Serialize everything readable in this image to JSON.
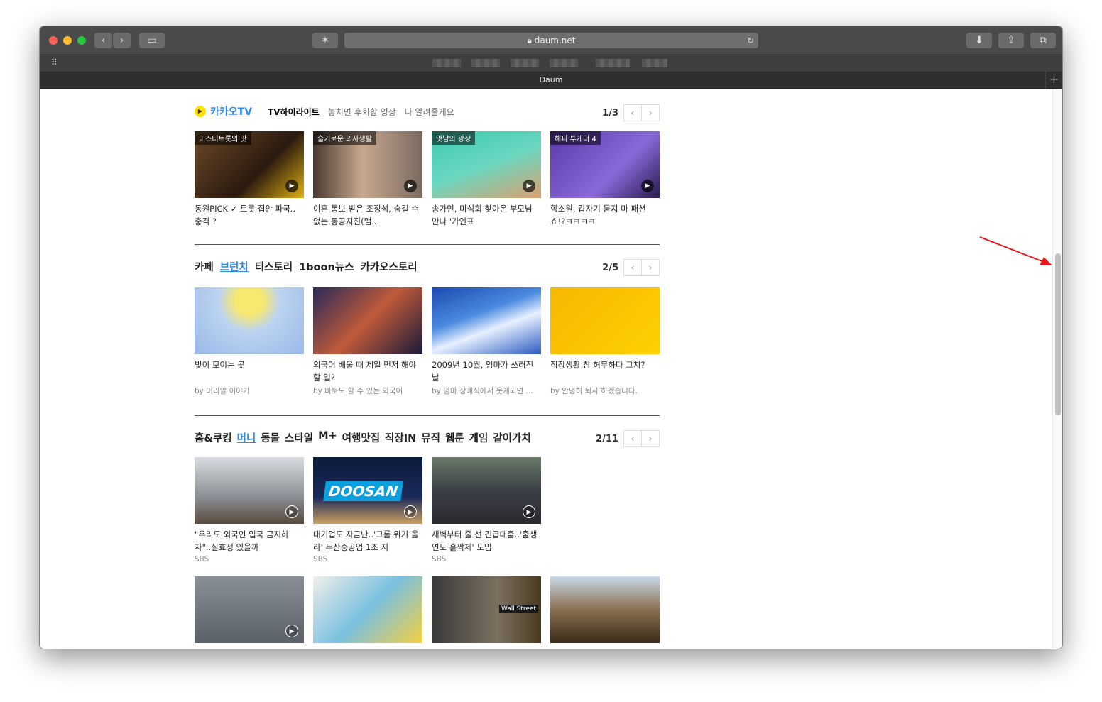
{
  "browser": {
    "url": "daum.net",
    "tab_title": "Daum",
    "new_tab": "+"
  },
  "kakaotv": {
    "brand": "카카오TV",
    "tabs": [
      "TV하이라이트",
      "놓치면 후회할 영상",
      "다 알려줄게요"
    ],
    "page": "1/3",
    "items": [
      {
        "tag": "미스터트롯의 맛",
        "title": "동원PICK ✓ 트롯 집안 파국.. 충격 ?"
      },
      {
        "tag": "슬기로운 의사생활",
        "title": "이혼 통보 받은 조정석, 숨길 수 없는 동공지진(맴..."
      },
      {
        "tag": "맛남의 광장",
        "title": "송가인, 미식회 찾아온 부모님 만나 '가인표"
      },
      {
        "tag": "해피 투게더 4",
        "title": "함소원, 갑자기 묻지 마 패션쇼!?ㅋㅋㅋㅋ"
      }
    ]
  },
  "cafe": {
    "tabs": [
      "카페",
      "브런치",
      "티스토리",
      "1boon뉴스",
      "카카오스토리"
    ],
    "active_tab": 1,
    "page": "2/5",
    "items": [
      {
        "title": "빛이 모이는 곳",
        "src": "by 머리말 이야기"
      },
      {
        "title": "외국어 배울 때 제일 먼저 해야 할 일?",
        "src": "by 바보도 할 수 있는 외국어"
      },
      {
        "title": "2009년 10월, 엄마가 쓰러진 날",
        "src": "by 엄마 장례식에서 웃게되면 ..."
      },
      {
        "title": "직장생활 참 허무하다 그치?",
        "src": "by 안녕히 퇴사 하겠습니다."
      }
    ]
  },
  "life": {
    "tabs": [
      "홈&쿠킹",
      "머니",
      "동물",
      "스타일",
      "M+",
      "여행맛집",
      "직장IN",
      "뮤직",
      "웹툰",
      "게임",
      "같이가치"
    ],
    "active_tab": 1,
    "page": "2/11",
    "items": [
      {
        "title": "\"우리도 외국인 입국 금지하자\"..실효성 있을까",
        "src": "SBS"
      },
      {
        "title": "대기업도 자금난..'그룹 위기 올라' 두산중공업 1조 지",
        "src": "SBS"
      },
      {
        "title": "새벽부터 줄 선 긴급대출..'출생연도 홀짝제' 도입",
        "src": "SBS"
      }
    ],
    "doosan_logo": "DOOSAN",
    "wall_street": "Wall Street"
  },
  "colors": {
    "accent": "#2d8bf0",
    "kakao_yellow": "#fae100"
  }
}
